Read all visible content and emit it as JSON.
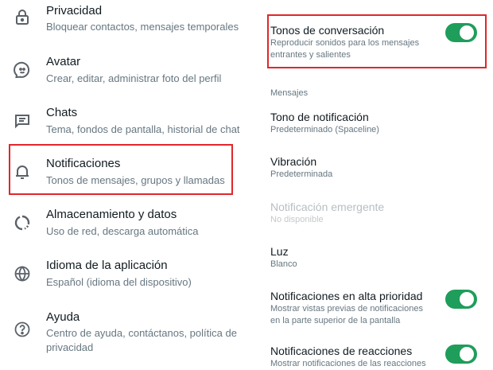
{
  "settings_menu": {
    "items": [
      {
        "key": "privacy",
        "icon": "lock-icon",
        "title": "Privacidad",
        "subtitle": "Bloquear contactos, mensajes temporales"
      },
      {
        "key": "avatar",
        "icon": "avatar-icon",
        "title": "Avatar",
        "subtitle": "Crear, editar, administrar foto del perfil"
      },
      {
        "key": "chats",
        "icon": "chat-icon",
        "title": "Chats",
        "subtitle": "Tema, fondos de pantalla, historial de chat"
      },
      {
        "key": "notifications",
        "icon": "bell-icon",
        "title": "Notificaciones",
        "subtitle": "Tonos de mensajes, grupos y llamadas"
      },
      {
        "key": "storage",
        "icon": "storage-icon",
        "title": "Almacenamiento y datos",
        "subtitle": "Uso de red, descarga automática"
      },
      {
        "key": "language",
        "icon": "globe-icon",
        "title": "Idioma de la aplicación",
        "subtitle": "Español (idioma del dispositivo)"
      },
      {
        "key": "help",
        "icon": "help-icon",
        "title": "Ayuda",
        "subtitle": "Centro de ayuda, contáctanos, política de privacidad"
      }
    ]
  },
  "notifications_panel": {
    "conversation_tones": {
      "title": "Tonos de conversación",
      "subtitle": "Reproducir sonidos para los mensajes entrantes y salientes",
      "enabled": true
    },
    "section_messages": "Mensajes",
    "notification_tone": {
      "title": "Tono de notificación",
      "value": "Predeterminado (Spaceline)"
    },
    "vibration": {
      "title": "Vibración",
      "value": "Predeterminada"
    },
    "popup": {
      "title": "Notificación emergente",
      "value": "No disponible",
      "disabled": true
    },
    "light": {
      "title": "Luz",
      "value": "Blanco"
    },
    "high_priority": {
      "title": "Notificaciones en alta prioridad",
      "subtitle": "Mostrar vistas previas de notificaciones en la parte superior de la pantalla",
      "enabled": true
    },
    "reactions": {
      "title": "Notificaciones de reacciones",
      "subtitle": "Mostrar notificaciones de las reacciones",
      "enabled": true
    }
  },
  "colors": {
    "accent": "#1f9d5b",
    "highlight": "#e0272b",
    "primary_text": "#111b21",
    "secondary_text": "#667781"
  }
}
